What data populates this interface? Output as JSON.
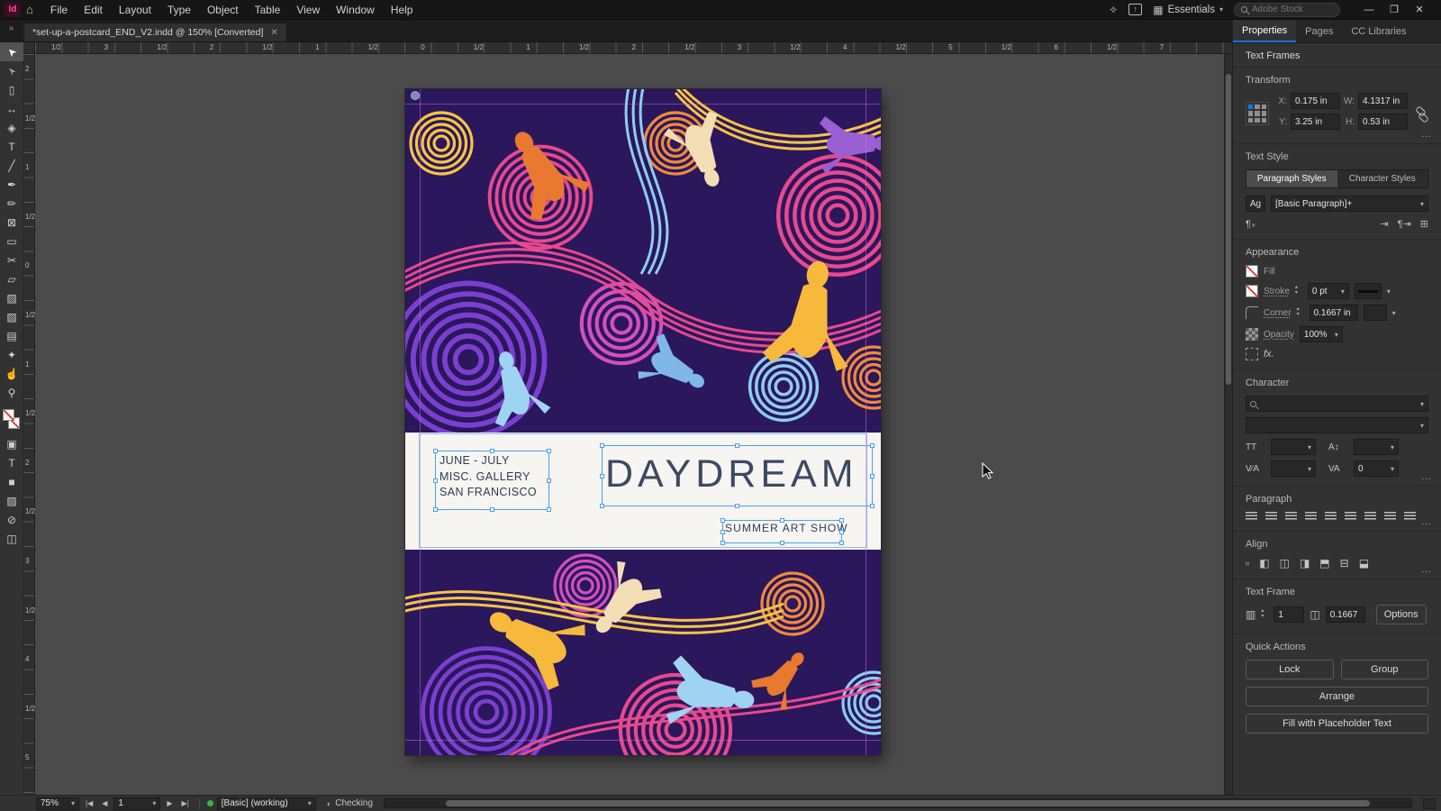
{
  "icons": {
    "chevron": "▾",
    "up": "▴",
    "down": "▾",
    "more": "…",
    "close": "✕",
    "minimize": "—",
    "restore": "❒",
    "home": "⌂",
    "learn": "✧",
    "share_arrow": "↑",
    "workspace": "▦",
    "first": "|◀",
    "prev": "◀",
    "next": "▶",
    "last": "▶|",
    "checking": "◐",
    "panel_expand": "»",
    "ag": "Ag",
    "fx": "fx.",
    "tt": "TT",
    "leading": "A↕",
    "kerning": "V∕A",
    "tracking": "VA",
    "pilcrow_plus": "¶₊",
    "indent_r": "⇥",
    "indent_p": "¶⇥",
    "grid": "⊞",
    "columns": "▥",
    "gutter": "◫"
  },
  "menubar": {
    "logo": "Id",
    "items": [
      "File",
      "Edit",
      "Layout",
      "Type",
      "Object",
      "Table",
      "View",
      "Window",
      "Help"
    ],
    "workspace": "Essentials",
    "search_placeholder": "Adobe Stock"
  },
  "tabbar": {
    "doc_title": "*set-up-a-postcard_END_V2.indd @ 150% [Converted]"
  },
  "toolbar": {
    "tools": [
      {
        "name": "selection-tool",
        "glyph": "➤",
        "rot": true,
        "selected": true
      },
      {
        "name": "direct-selection-tool",
        "glyph": "➢",
        "rot": true
      },
      {
        "name": "page-tool",
        "glyph": "▯"
      },
      {
        "name": "gap-tool",
        "glyph": "↔"
      },
      {
        "name": "content-collector-tool",
        "glyph": "◈"
      },
      {
        "name": "type-tool",
        "glyph": "T"
      },
      {
        "name": "line-tool",
        "glyph": "╱"
      },
      {
        "name": "pen-tool",
        "glyph": "✒"
      },
      {
        "name": "pencil-tool",
        "glyph": "✏"
      },
      {
        "name": "rectangle-frame-tool",
        "glyph": "⊠"
      },
      {
        "name": "rectangle-tool",
        "glyph": "▭"
      },
      {
        "name": "scissors-tool",
        "glyph": "✂"
      },
      {
        "name": "free-transform-tool",
        "glyph": "▱"
      },
      {
        "name": "gradient-swatch-tool",
        "glyph": "▨"
      },
      {
        "name": "gradient-feather-tool",
        "glyph": "▧"
      },
      {
        "name": "note-tool",
        "glyph": "▤"
      },
      {
        "name": "eyedropper-tool",
        "glyph": "✦"
      },
      {
        "name": "hand-tool",
        "glyph": "☝"
      },
      {
        "name": "zoom-tool",
        "glyph": "⚲"
      }
    ],
    "extras": [
      {
        "name": "formatting-affects-container",
        "glyph": "▣"
      },
      {
        "name": "formatting-affects-text",
        "glyph": "T"
      },
      {
        "name": "apply-color",
        "glyph": "■"
      },
      {
        "name": "apply-gradient",
        "glyph": "▨"
      },
      {
        "name": "apply-none",
        "glyph": "⊘"
      },
      {
        "name": "screen-mode",
        "glyph": "◫"
      }
    ]
  },
  "rulers": {
    "top": [
      "1/2",
      "3",
      "1/2",
      "2",
      "1/2",
      "1",
      "1/2",
      "0",
      "1/2",
      "1",
      "1/2",
      "2",
      "1/2",
      "3",
      "1/2",
      "4",
      "1/2",
      "5",
      "1/2",
      "6",
      "1/2",
      "7"
    ],
    "left": [
      "2",
      "1/2",
      "1",
      "1/2",
      "0",
      "1/2",
      "1",
      "1/2",
      "2",
      "1/2",
      "3",
      "1/2",
      "4",
      "1/2",
      "5"
    ]
  },
  "postcard": {
    "dates": "JUNE - JULY",
    "gallery": "MISC. GALLERY",
    "city": "SAN FRANCISCO",
    "title": "DAYDREAM",
    "subtitle": "SUMMER ART SHOW"
  },
  "panel": {
    "tabs": [
      {
        "label": "Properties",
        "active": true
      },
      {
        "label": "Pages",
        "active": false
      },
      {
        "label": "CC Libraries",
        "active": false
      }
    ],
    "selection_type": "Text Frames",
    "transform": {
      "title": "Transform",
      "x_label": "X:",
      "x": "0.175 in",
      "y_label": "Y:",
      "y": "3.25 in",
      "w_label": "W:",
      "w": "4.1317 in",
      "h_label": "H:",
      "h": "0.53 in"
    },
    "text_style": {
      "title": "Text Style",
      "tab_paragraph": "Paragraph Styles",
      "tab_character": "Character Styles",
      "style": "[Basic Paragraph]+"
    },
    "appearance": {
      "title": "Appearance",
      "fill": "Fill",
      "stroke": "Stroke",
      "stroke_weight": "0 pt",
      "corner": "Corner",
      "corner_radius": "0.1667 in",
      "opacity": "Opacity",
      "opacity_value": "100%"
    },
    "character": {
      "title": "Character",
      "tracking": "0"
    },
    "paragraph": {
      "title": "Paragraph",
      "icon_names": [
        "align-left",
        "align-center",
        "align-right",
        "justify-left",
        "justify-center",
        "justify-right",
        "justify-all",
        "indent-left",
        "indent-right"
      ]
    },
    "align": {
      "title": "Align",
      "icons": [
        {
          "name": "align-key-object",
          "glyph": "▫"
        },
        {
          "name": "align-left",
          "glyph": "◧"
        },
        {
          "name": "align-center-horizontal",
          "glyph": "◫"
        },
        {
          "name": "align-right",
          "glyph": "◨"
        },
        {
          "name": "align-top",
          "glyph": "⬒"
        },
        {
          "name": "align-center-vertical",
          "glyph": "⊟"
        },
        {
          "name": "align-bottom",
          "glyph": "⬓"
        }
      ]
    },
    "text_frame": {
      "title": "Text Frame",
      "columns": "1",
      "inset": "0.1667",
      "options": "Options"
    },
    "quick_actions": {
      "title": "Quick Actions",
      "row": [
        "Lock",
        "Group"
      ],
      "stack": [
        "Arrange",
        "Fill with Placeholder Text"
      ]
    }
  },
  "statusbar": {
    "zoom": "75%",
    "page": "1",
    "preflight": "[Basic] (working)",
    "check": "Checking"
  }
}
